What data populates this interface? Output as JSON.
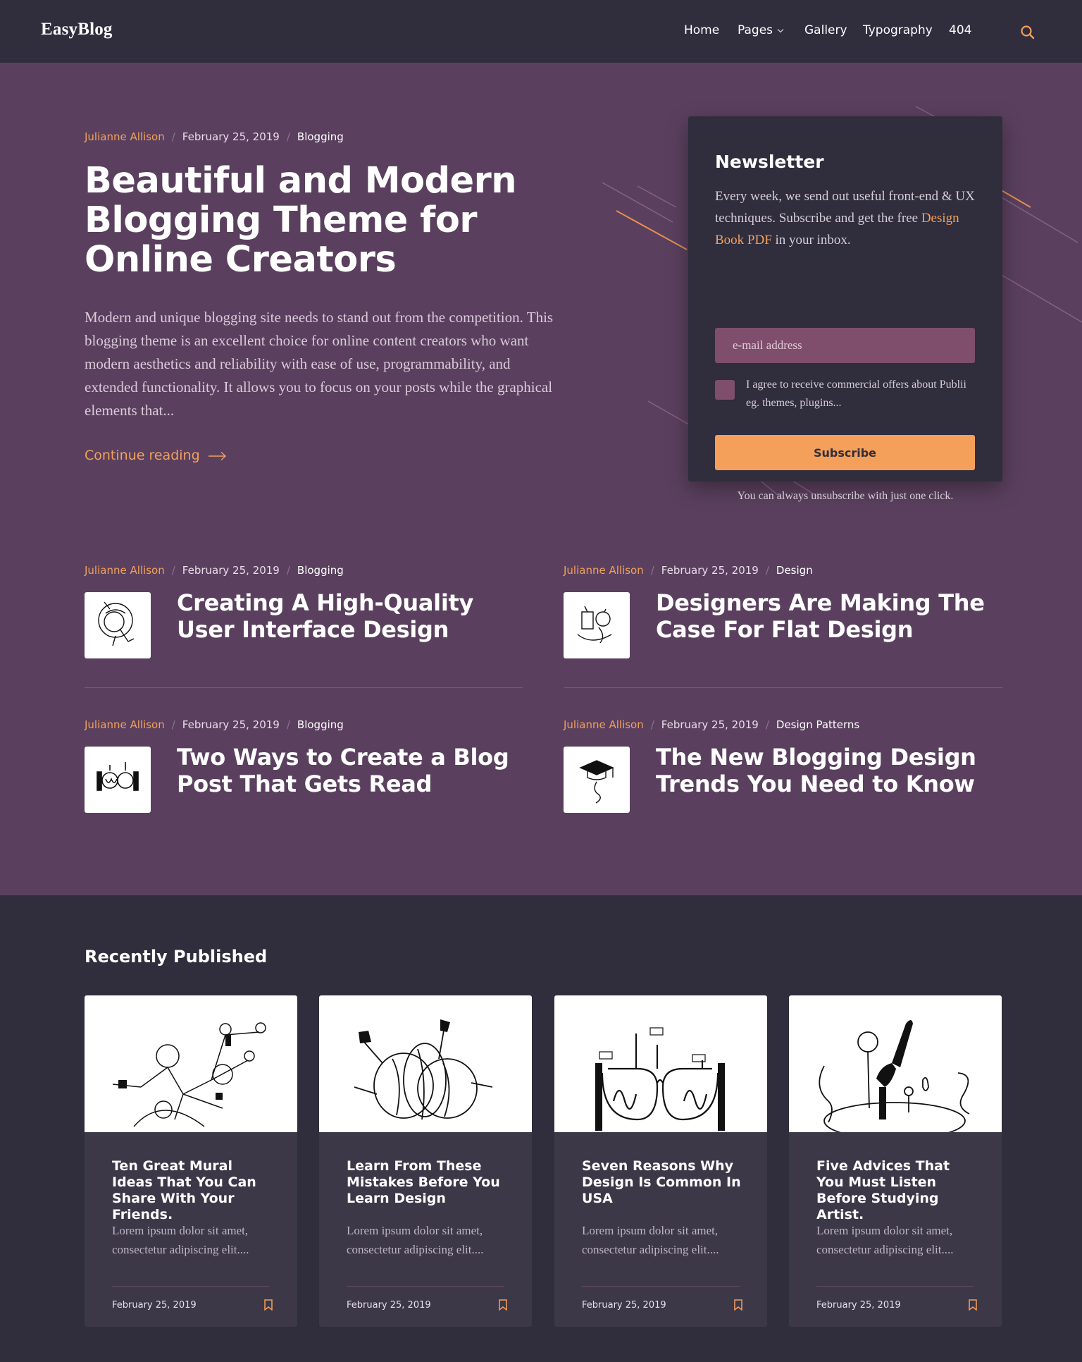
{
  "brand": {
    "logo": "EasyBlog",
    "accent": "#f2a05c",
    "hero_bg": "#5a405e",
    "dark_bg": "#302d3d"
  },
  "nav": {
    "items": [
      "Home",
      "Pages",
      "Gallery",
      "Typography",
      "404"
    ],
    "search_icon": "search-icon"
  },
  "hero": {
    "author": "Julianne Allison",
    "date": "February 25, 2019",
    "category": "Blogging",
    "title": "Beautiful and Modern Blogging Theme for Online Creators",
    "excerpt": "Modern and unique blogging site needs to stand out from the competition. This blogging theme is an excellent choice for online content creators who want modern aesthetics and reliability with ease of use, programmability, and extended functionality. It allows you to focus on your posts while the graphical elements that...",
    "continue_label": "Continue reading"
  },
  "newsletter": {
    "title": "Newsletter",
    "text_before": "Every week, we send out useful front-end & UX techniques. Subscribe and get the free ",
    "link": "Design Book PDF",
    "text_after": " in your inbox.",
    "input_placeholder": "e-mail address",
    "agree": "I agree to receive commercial offers about Publii eg. themes, plugins...",
    "button": "Subscribe",
    "footnote": "You can always unsubscribe with just one click."
  },
  "featured": [
    {
      "author": "Julianne Allison",
      "date": "February 25, 2019",
      "category": "Blogging",
      "title": "Creating A High-Quality User Interface Design"
    },
    {
      "author": "Julianne Allison",
      "date": "February 25, 2019",
      "category": "Design",
      "title": "Designers Are Making The Case For Flat Design"
    },
    {
      "author": "Julianne Allison",
      "date": "February 25, 2019",
      "category": "Blogging",
      "title": "Two Ways to Create a Blog Post That Gets Read"
    },
    {
      "author": "Julianne Allison",
      "date": "February 25, 2019",
      "category": "Design Patterns",
      "title": "The New Blogging Design Trends You Need to Know"
    }
  ],
  "recent": {
    "title": "Recently Published",
    "cards": [
      {
        "title": "Ten Great Mural Ideas That You Can Share With Your Friends.",
        "text": "Lorem ipsum dolor sit amet, consectetur adipiscing elit....",
        "date": "February 25, 2019"
      },
      {
        "title": "Learn From These Mistakes Before You Learn Design",
        "text": "Lorem ipsum dolor sit amet, consectetur adipiscing elit....",
        "date": "February 25, 2019"
      },
      {
        "title": "Seven Reasons Why Design Is Common In USA",
        "text": "Lorem ipsum dolor sit amet, consectetur adipiscing elit....",
        "date": "February 25, 2019"
      },
      {
        "title": "Five Advices That You Must Listen Before Studying Artist.",
        "text": "Lorem ipsum dolor sit amet, consectetur adipiscing elit....",
        "date": "February 25, 2019"
      }
    ]
  }
}
